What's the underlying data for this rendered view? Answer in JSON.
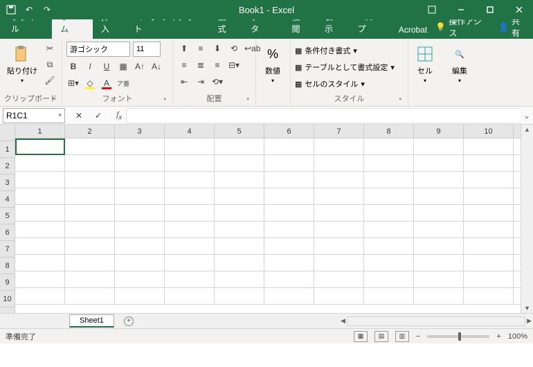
{
  "title": "Book1 - Excel",
  "tabs": [
    "ファイル",
    "ホーム",
    "挿入",
    "ページ レイアウト",
    "数式",
    "データ",
    "校閲",
    "表示",
    "ヘルプ",
    "Acrobat"
  ],
  "active_tab": 1,
  "tell_me": "操作アシス",
  "share": "共有",
  "ribbon": {
    "clipboard": {
      "paste": "貼り付け",
      "label": "クリップボード"
    },
    "font": {
      "name": "游ゴシック",
      "size": "11",
      "label": "フォント",
      "ruby": "ア亜"
    },
    "alignment": {
      "label": "配置"
    },
    "number": {
      "btn": "数値",
      "label": "数値"
    },
    "styles": {
      "conditional": "条件付き書式",
      "table": "テーブルとして書式設定",
      "cell": "セルのスタイル",
      "label": "スタイル"
    },
    "cells": {
      "btn": "セル"
    },
    "editing": {
      "btn": "編集"
    }
  },
  "namebox": "R1C1",
  "formula": "",
  "columns": [
    "1",
    "2",
    "3",
    "4",
    "5",
    "6",
    "7",
    "8",
    "9",
    "10"
  ],
  "rows": [
    "1",
    "2",
    "3",
    "4",
    "5",
    "6",
    "7",
    "8",
    "9",
    "10"
  ],
  "sheet": "Sheet1",
  "status": "準備完了",
  "zoom": "100%"
}
